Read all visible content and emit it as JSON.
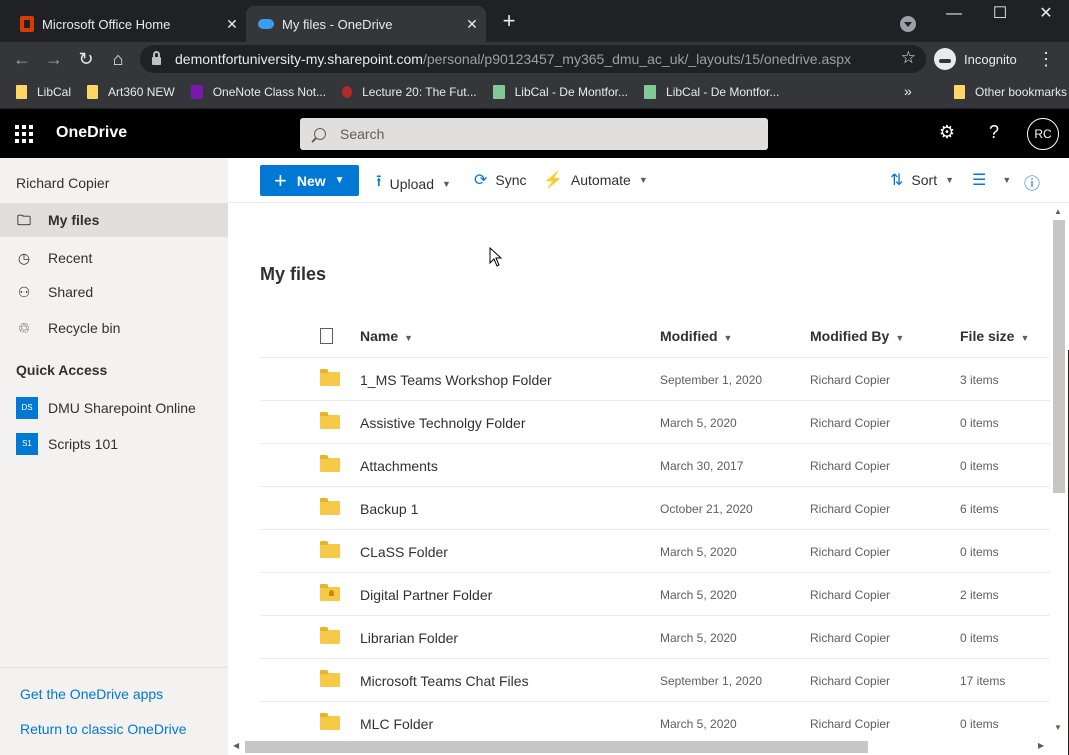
{
  "browser": {
    "tabs": [
      {
        "title": "Microsoft Office Home",
        "active": false,
        "icon": "office-icon"
      },
      {
        "title": "My files - OneDrive",
        "active": true,
        "icon": "onedrive-icon"
      }
    ],
    "url_host": "demontfortuniversity-my.sharepoint.com",
    "url_path": "/personal/p90123457_my365_dmu_ac_uk/_layouts/15/onedrive.aspx",
    "incognito_label": "Incognito",
    "bookmarks": [
      {
        "label": "LibCal",
        "icon": "folder-icon"
      },
      {
        "label": "Art360 NEW",
        "icon": "folder-icon"
      },
      {
        "label": "OneNote Class Not...",
        "icon": "onenote-icon"
      },
      {
        "label": "Lecture 20: The Fut...",
        "icon": "site-icon"
      },
      {
        "label": "LibCal - De Montfor...",
        "icon": "calendar-icon"
      },
      {
        "label": "LibCal - De Montfor...",
        "icon": "calendar-icon"
      }
    ],
    "more_bookmarks": "»",
    "other_bookmarks": "Other bookmarks"
  },
  "header": {
    "app_name": "OneDrive",
    "search_placeholder": "Search",
    "avatar_initials": "RC"
  },
  "nav": {
    "user_name": "Richard Copier",
    "items": [
      {
        "label": "My files",
        "icon": "folder-icon",
        "selected": true
      },
      {
        "label": "Recent",
        "icon": "history-icon",
        "selected": false
      },
      {
        "label": "Shared",
        "icon": "people-icon",
        "selected": false
      },
      {
        "label": "Recycle bin",
        "icon": "recycle-bin-icon",
        "selected": false
      }
    ],
    "quick_access_title": "Quick Access",
    "quick_access": [
      {
        "label": "DMU Sharepoint Online",
        "badge": "DS"
      },
      {
        "label": "Scripts 101",
        "badge": "S1"
      }
    ],
    "get_apps": "Get the OneDrive apps",
    "classic": "Return to classic OneDrive"
  },
  "commands": {
    "new": "New",
    "upload": "Upload",
    "sync": "Sync",
    "automate": "Automate",
    "sort": "Sort"
  },
  "main": {
    "title": "My files",
    "columns": {
      "name": "Name",
      "modified": "Modified",
      "modified_by": "Modified By",
      "file_size": "File size"
    },
    "rows": [
      {
        "name": "1_MS Teams Workshop Folder",
        "modified": "September 1, 2020",
        "modified_by": "Richard Copier",
        "size": "3 items",
        "shared": false
      },
      {
        "name": "Assistive Technolgy Folder",
        "modified": "March 5, 2020",
        "modified_by": "Richard Copier",
        "size": "0 items",
        "shared": false
      },
      {
        "name": "Attachments",
        "modified": "March 30, 2017",
        "modified_by": "Richard Copier",
        "size": "0 items",
        "shared": false
      },
      {
        "name": "Backup 1",
        "modified": "October 21, 2020",
        "modified_by": "Richard Copier",
        "size": "6 items",
        "shared": false
      },
      {
        "name": "CLaSS Folder",
        "modified": "March 5, 2020",
        "modified_by": "Richard Copier",
        "size": "0 items",
        "shared": false
      },
      {
        "name": "Digital Partner Folder",
        "modified": "March 5, 2020",
        "modified_by": "Richard Copier",
        "size": "2 items",
        "shared": true
      },
      {
        "name": "Librarian Folder",
        "modified": "March 5, 2020",
        "modified_by": "Richard Copier",
        "size": "0 items",
        "shared": false
      },
      {
        "name": "Microsoft Teams Chat Files",
        "modified": "September 1, 2020",
        "modified_by": "Richard Copier",
        "size": "17 items",
        "shared": false
      },
      {
        "name": "MLC Folder",
        "modified": "March 5, 2020",
        "modified_by": "Richard Copier",
        "size": "0 items",
        "shared": false
      }
    ]
  },
  "colors": {
    "accent": "#0078d4",
    "header_bg": "#000000",
    "nav_bg": "#f3f2f1",
    "folder": "#f7c948"
  }
}
